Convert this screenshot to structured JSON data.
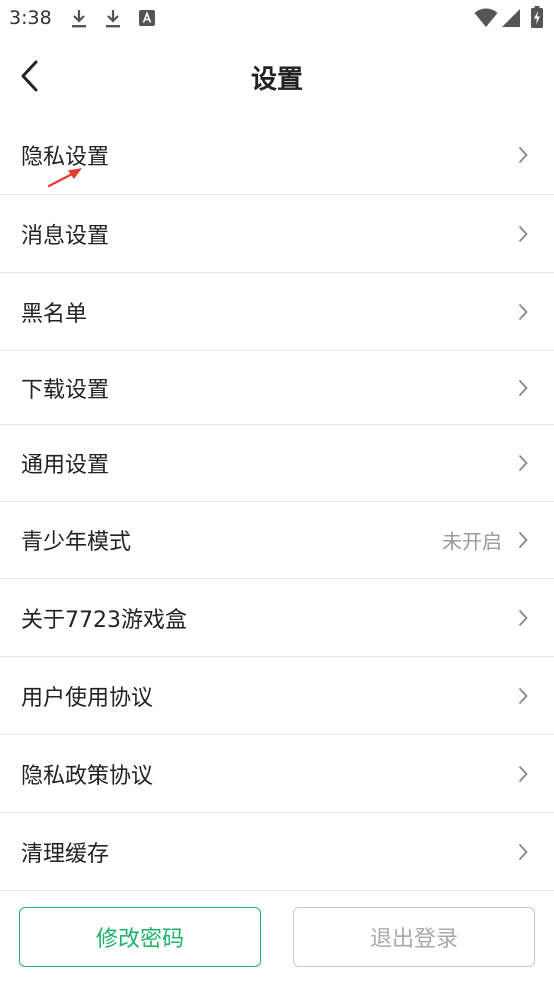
{
  "status_bar": {
    "time": "3:38",
    "icons": [
      "download-icon",
      "download-icon",
      "a-notification-icon",
      "wifi-icon",
      "signal-icon",
      "battery-charging-icon"
    ]
  },
  "header": {
    "title": "设置",
    "back_icon": "chevron-left-icon"
  },
  "menu": {
    "items": [
      {
        "label": "隐私设置",
        "value": ""
      },
      {
        "label": "消息设置",
        "value": ""
      },
      {
        "label": "黑名单",
        "value": ""
      },
      {
        "label": "下载设置",
        "value": ""
      },
      {
        "label": "通用设置",
        "value": ""
      },
      {
        "label": "青少年模式",
        "value": "未开启"
      },
      {
        "label": "关于7723游戏盒",
        "value": ""
      },
      {
        "label": "用户使用协议",
        "value": ""
      },
      {
        "label": "隐私政策协议",
        "value": ""
      },
      {
        "label": "清理缓存",
        "value": ""
      }
    ]
  },
  "footer": {
    "change_password_label": "修改密码",
    "logout_label": "退出登录"
  },
  "colors": {
    "accent": "#1db36a",
    "annotation_arrow": "#e83a2f",
    "secondary_text": "#999999",
    "divider": "#e6e6e6"
  }
}
